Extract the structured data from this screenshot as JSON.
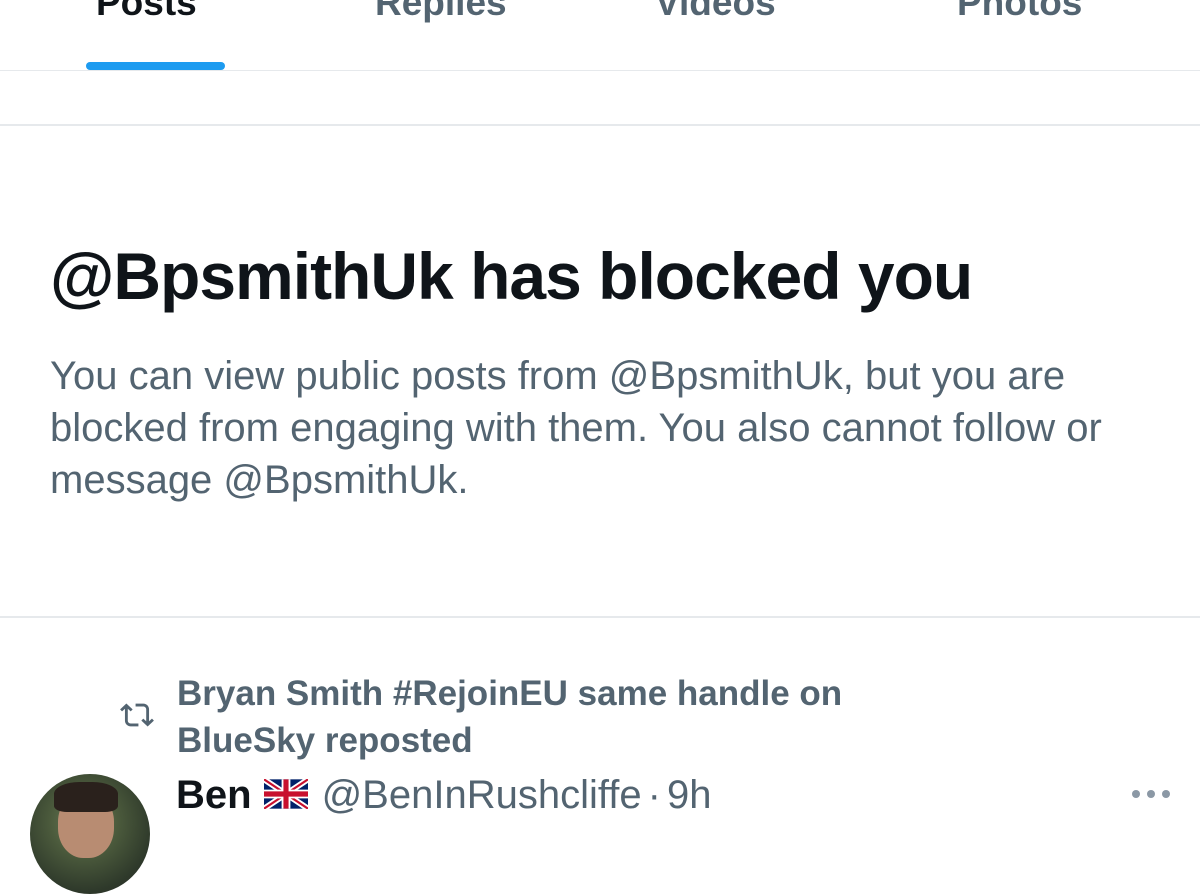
{
  "tabs": [
    {
      "label": "Posts",
      "active": true
    },
    {
      "label": "Replies",
      "active": false
    },
    {
      "label": "Videos",
      "active": false
    },
    {
      "label": "Photos",
      "active": false
    }
  ],
  "blocked": {
    "title": "@BpsmithUk has blocked you",
    "description": "You can view public posts from @BpsmithUk, but you are blocked from engaging with them. You also cannot follow or message @BpsmithUk."
  },
  "post": {
    "repost_text": "Bryan Smith #RejoinEU same handle on BlueSky reposted",
    "author_name": "Ben",
    "author_flag": "🇬🇧",
    "author_handle": "@BenInRushcliffe",
    "separator": "·",
    "time": "9h"
  },
  "icons": {
    "repost": "repost-icon",
    "more": "more-options-icon",
    "flag": "uk-flag-icon"
  },
  "colors": {
    "accent": "#1d9bf0",
    "text_primary": "#0f1419",
    "text_secondary": "#536471",
    "divider": "#e6e9ec"
  }
}
